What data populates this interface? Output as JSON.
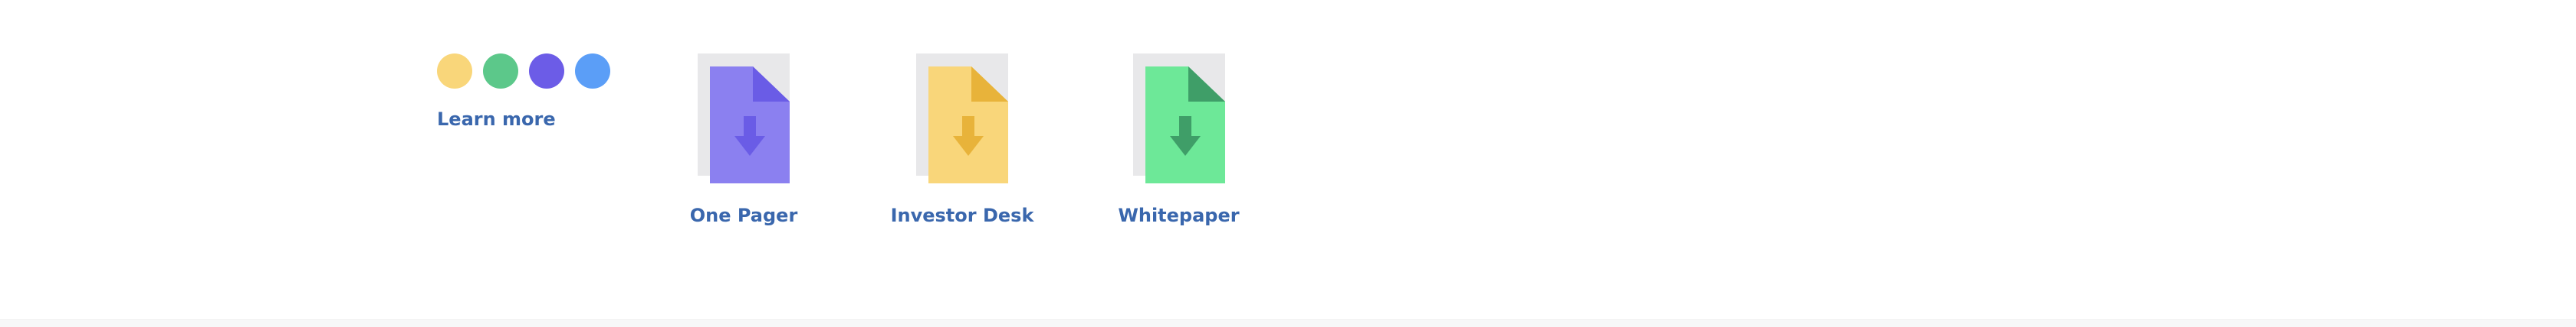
{
  "colors": {
    "link": "#3a67ad",
    "dots": [
      "#f9d67a",
      "#5cc88a",
      "#6c5ce7",
      "#5b9ef7"
    ],
    "shadow": "#e8e8ea"
  },
  "learn_more_label": "Learn more",
  "documents": [
    {
      "label": "One Pager",
      "icon": "file-download-icon",
      "body_color": "#8b80f0",
      "accent_color": "#6a5ce6"
    },
    {
      "label": "Investor Desk",
      "icon": "file-download-icon",
      "body_color": "#f9d67a",
      "accent_color": "#e8b33a"
    },
    {
      "label": "Whitepaper",
      "icon": "file-download-icon",
      "body_color": "#6de898",
      "accent_color": "#3f9e68"
    }
  ]
}
